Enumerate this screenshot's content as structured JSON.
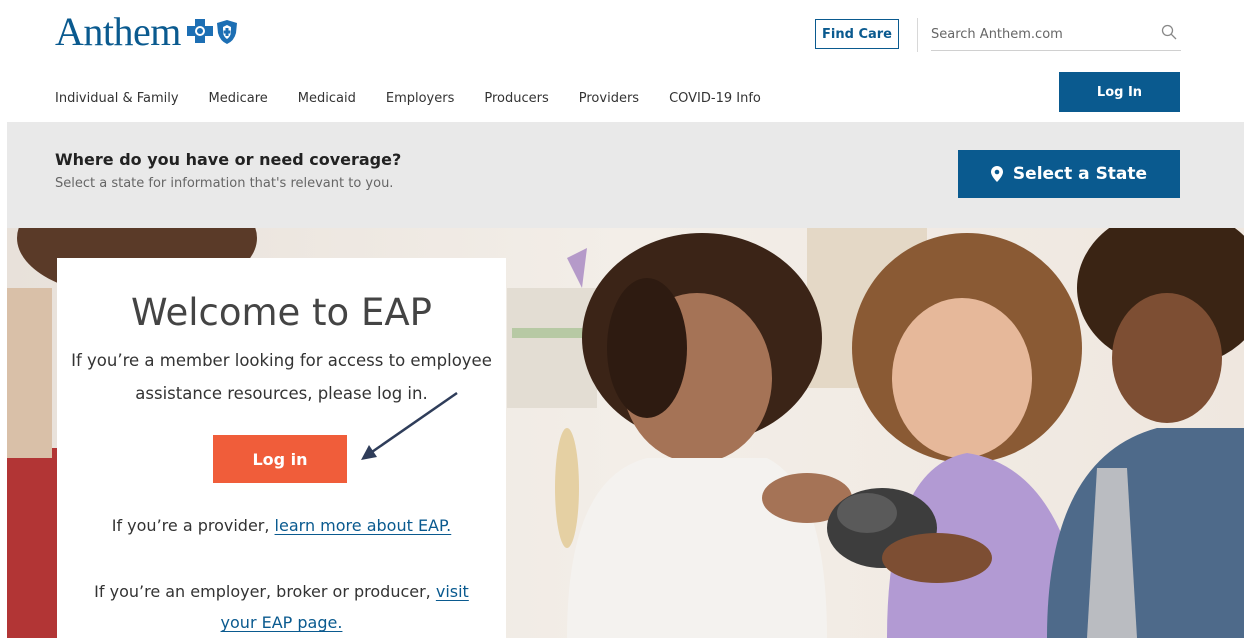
{
  "header": {
    "logo_text": "Anthem",
    "find_care_label": "Find Care",
    "search_placeholder": "Search Anthem.com",
    "login_label": "Log In"
  },
  "nav": {
    "items": [
      "Individual & Family",
      "Medicare",
      "Medicaid",
      "Employers",
      "Producers",
      "Providers",
      "COVID-19 Info"
    ]
  },
  "coverage": {
    "question": "Where do you have or need coverage?",
    "subtitle": "Select a state for information that's relevant to you.",
    "select_state_label": "Select a State"
  },
  "welcome": {
    "title": "Welcome to EAP",
    "intro": "If you’re a member looking for access to employee assistance resources, please log in.",
    "login_label": "Log in",
    "provider_prefix": "If you’re a provider,",
    "provider_link": "learn more about EAP.",
    "employer_prefix": "If you’re an employer, broker or producer,",
    "employer_link": "visit your EAP page."
  },
  "colors": {
    "brand_blue": "#0a5a8f",
    "cta_orange": "#f05d3a",
    "coverage_bg": "#e9e9e9"
  },
  "icons": [
    "blue-cross-icon",
    "blue-shield-icon",
    "search-icon",
    "location-pin-icon",
    "annotation-arrow-icon"
  ]
}
